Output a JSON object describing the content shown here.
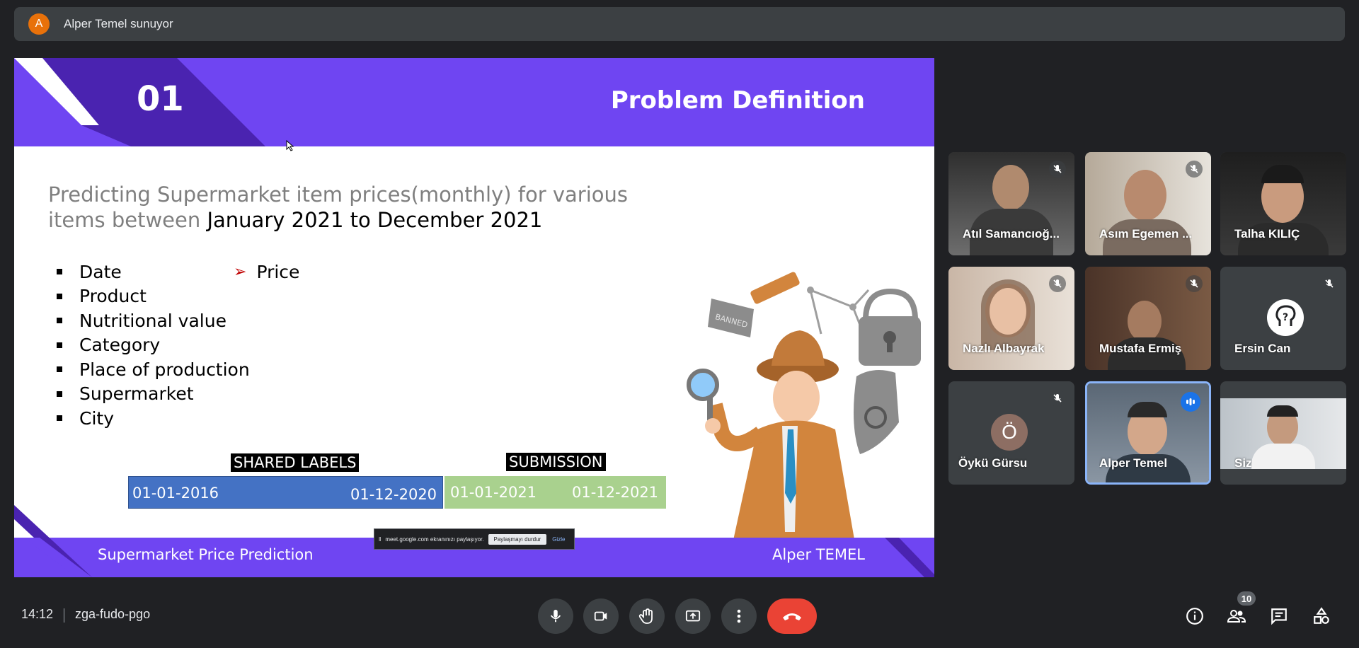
{
  "presenter": {
    "avatar_letter": "A",
    "text": "Alper Temel sunuyor"
  },
  "slide": {
    "number": "01",
    "title": "Problem Definition",
    "desc_part1": "Predicting Supermarket item prices(monthly) for various items between ",
    "desc_part2": "January 2021 to December 2021",
    "bullets": [
      "Date",
      "Product",
      "Nutritional value",
      "Category",
      "Place of production",
      "Supermarket",
      "City"
    ],
    "arrow_item": "Price",
    "label_shared": "SHARED LABELS",
    "label_submission": "SUBMISSION",
    "shared_start": "01-01-2016",
    "shared_end": "01-12-2020",
    "submission_start": "01-01-2021",
    "submission_end": "01-12-2021",
    "footer_left": "Supermarket Price Prediction",
    "footer_right": "Alper TEMEL"
  },
  "share_notice": {
    "text": "meet.google.com ekranınızı paylaşıyor.",
    "stop_label": "Paylaşmayı durdur",
    "hide_label": "Gizle"
  },
  "participants": [
    {
      "name": "Atıl Samancıoğ...",
      "muted": true
    },
    {
      "name": "Asım Egemen ...",
      "muted": true
    },
    {
      "name": "Talha KILIÇ",
      "muted": false
    },
    {
      "name": "Nazlı Albayrak",
      "muted": true
    },
    {
      "name": "Mustafa Ermiş",
      "muted": true
    },
    {
      "name": "Ersin Can",
      "muted": true
    },
    {
      "name": "Öykü Gürsu",
      "muted": true,
      "avatar_letter": "Ö"
    },
    {
      "name": "Alper Temel",
      "speaking": true
    },
    {
      "name": "Siz",
      "muted": false
    }
  ],
  "toolbar": {
    "time": "14:12",
    "meeting_code": "zga-fudo-pgo",
    "people_count": "10"
  },
  "colors": {
    "slide_purple": "#6f45f2",
    "slide_dark_purple": "#4a23b0",
    "end_call": "#ea4335",
    "speaking_blue": "#1a73e8"
  }
}
